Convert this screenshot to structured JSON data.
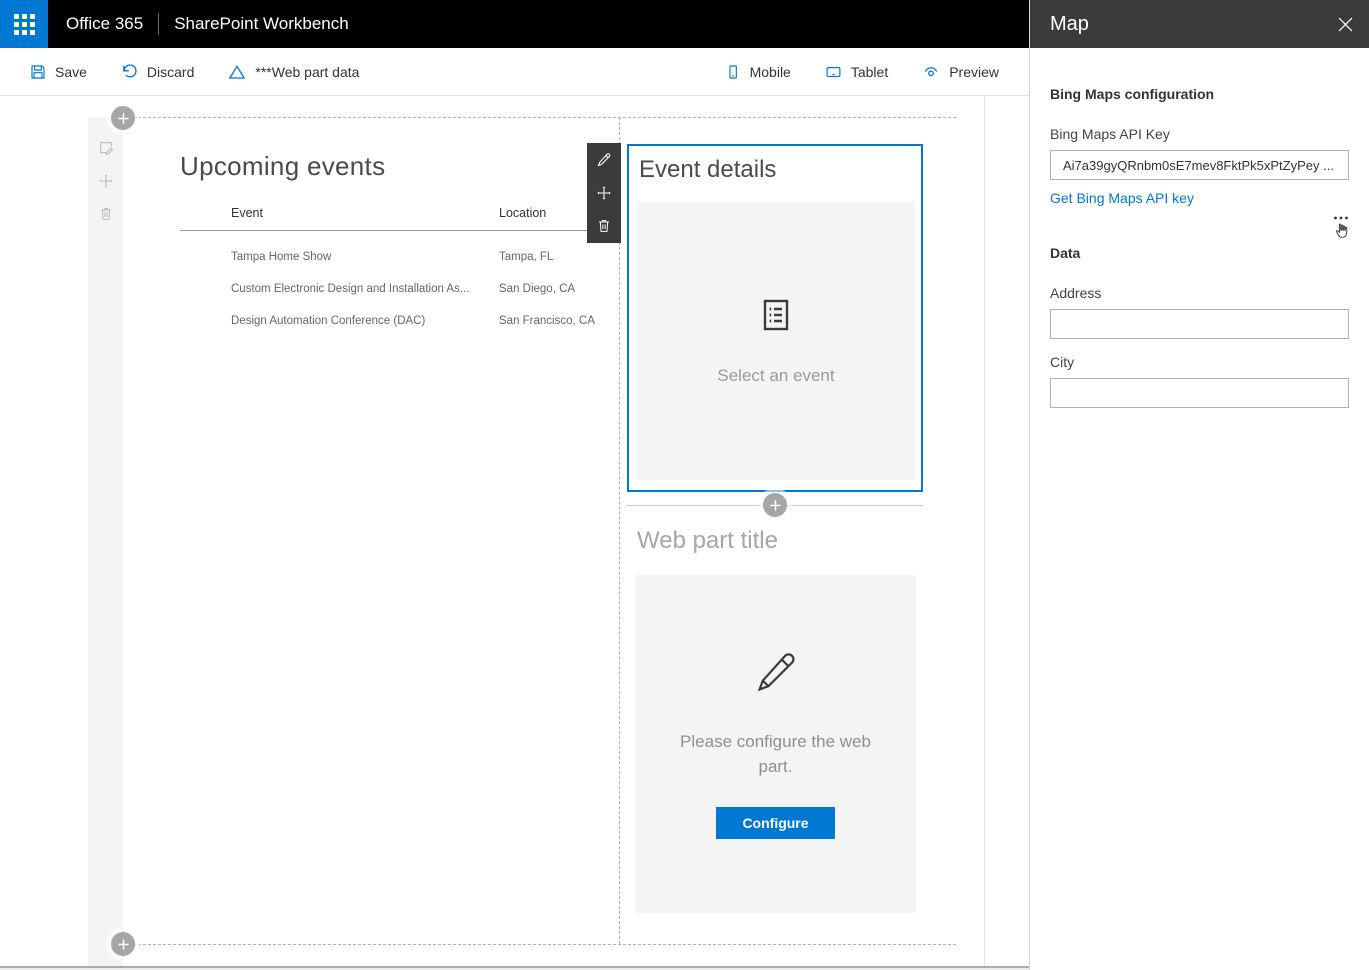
{
  "header": {
    "brand": "Office 365",
    "app_title": "SharePoint Workbench"
  },
  "command_bar": {
    "save_label": "Save",
    "discard_label": "Discard",
    "webpart_data_label": "***Web part data",
    "mobile_label": "Mobile",
    "tablet_label": "Tablet",
    "preview_label": "Preview"
  },
  "canvas": {
    "upcoming_events": {
      "title": "Upcoming events",
      "table": {
        "columns": [
          "Event",
          "Location"
        ],
        "rows": [
          [
            "Tampa Home Show",
            "Tampa, FL"
          ],
          [
            "Custom Electronic Design and Installation As...",
            "San Diego, CA"
          ],
          [
            "Design Automation Conference (DAC)",
            "San Francisco, CA"
          ]
        ]
      }
    },
    "event_details": {
      "title": "Event details",
      "placeholder_text": "Select an event"
    },
    "map_webpart": {
      "title": "Web part title",
      "configure_message": "Please configure the web part.",
      "configure_button_label": "Configure"
    }
  },
  "property_panel": {
    "title": "Map",
    "group_1_title": "Bing Maps configuration",
    "api_key_label": "Bing Maps API Key",
    "api_key_value": "Ai7a39gyQRnbm0sE7mev8FktPk5xPtZyPey ...",
    "api_key_link": "Get Bing Maps API key",
    "group_2_title": "Data",
    "address_label": "Address",
    "address_value": "",
    "city_label": "City",
    "city_value": ""
  },
  "icons": {
    "app_launcher": "waffle-grid",
    "save": "floppy-disk",
    "discard": "undo-arrow",
    "webpart_data": "warning-triangle",
    "mobile": "phone-outline",
    "tablet": "tablet-outline",
    "preview": "eye",
    "edit": "pencil",
    "move": "move-arrows",
    "delete": "trash-can",
    "add": "plus-circle",
    "close": "x",
    "more": "ellipsis",
    "event_placeholder": "document-list",
    "cursor": "hand-pointer"
  },
  "colors": {
    "accent": "#0078d4",
    "suite_bar_bg": "#000000",
    "panel_header_bg": "#3b3b3b",
    "webpart_toolbar_bg": "#3b3b3b",
    "placeholder_bg": "#f4f4f4",
    "link": "#0078d4"
  }
}
